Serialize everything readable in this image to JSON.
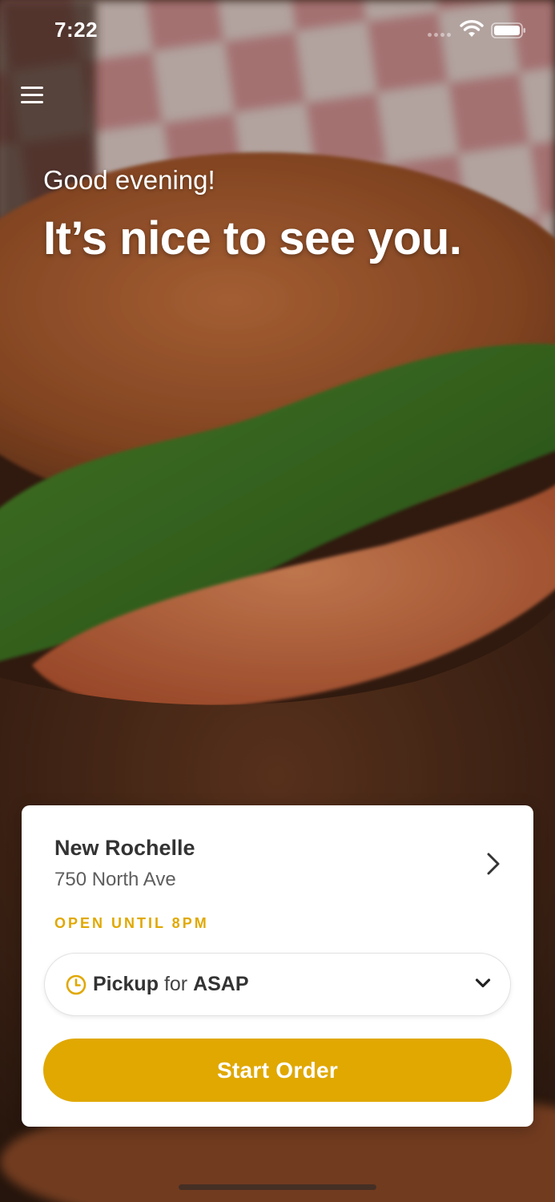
{
  "status_bar": {
    "time": "7:22"
  },
  "greeting": {
    "subtitle": "Good evening!",
    "headline": "It’s nice to see you."
  },
  "location": {
    "name": "New Rochelle",
    "address": "750 North Ave",
    "hours": "OPEN UNTIL 8PM"
  },
  "pickup": {
    "mode": "Pickup",
    "connector": "for",
    "time": "ASAP"
  },
  "actions": {
    "start_order_label": "Start Order"
  },
  "colors": {
    "accent": "#e0a800",
    "card_bg": "#ffffff",
    "title_text": "#333333"
  },
  "icons": {
    "menu": "hamburger-menu-icon",
    "location_arrow": "chevron-right-icon",
    "time": "clock-icon",
    "dropdown": "chevron-down-icon",
    "wifi": "wifi-icon",
    "battery": "battery-icon"
  }
}
